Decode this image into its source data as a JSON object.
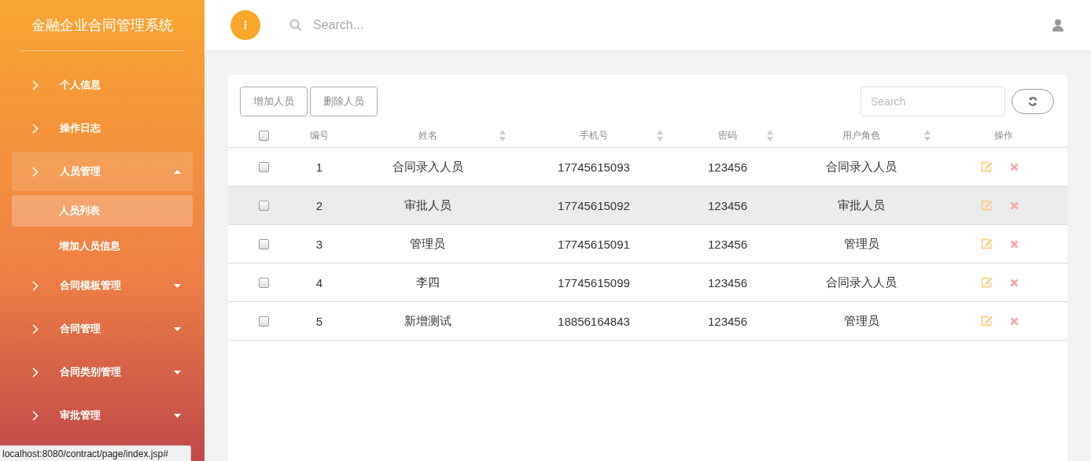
{
  "sidebar": {
    "title": "金融企业合同管理系统",
    "items": [
      {
        "label": "个人信息",
        "kind": "link"
      },
      {
        "label": "操作日志",
        "kind": "link"
      },
      {
        "label": "人员管理",
        "kind": "group",
        "expanded": true,
        "children": [
          {
            "label": "人员列表",
            "selected": true
          },
          {
            "label": "增加人员信息",
            "selected": false
          }
        ]
      },
      {
        "label": "合同模板管理",
        "kind": "group",
        "expanded": false
      },
      {
        "label": "合同管理",
        "kind": "group",
        "expanded": false
      },
      {
        "label": "合同类别管理",
        "kind": "group",
        "expanded": false
      },
      {
        "label": "审批管理",
        "kind": "group",
        "expanded": false
      }
    ]
  },
  "header": {
    "search": {
      "placeholder": "Search..."
    }
  },
  "toolbar": {
    "buttons": [
      "增加人员",
      "删除人员"
    ],
    "search": {
      "placeholder": "Search"
    }
  },
  "table": {
    "select_all": {
      "checked": false
    },
    "columns": [
      {
        "label": "编号",
        "sortable": false
      },
      {
        "label": "姓名",
        "sortable": true
      },
      {
        "label": "手机号",
        "sortable": true
      },
      {
        "label": "密码",
        "sortable": true
      },
      {
        "label": "用户角色",
        "sortable": true
      },
      {
        "label": "操作",
        "sortable": false
      }
    ],
    "rows": [
      {
        "checked": false,
        "hovered": false,
        "cells": [
          "1",
          "合同录入人员",
          "17745615093",
          "123456",
          "合同录入人员"
        ]
      },
      {
        "checked": false,
        "hovered": true,
        "cells": [
          "2",
          "审批人员",
          "17745615092",
          "123456",
          "审批人员"
        ]
      },
      {
        "checked": false,
        "hovered": false,
        "cells": [
          "3",
          "管理员",
          "17745615091",
          "123456",
          "管理员"
        ]
      },
      {
        "checked": false,
        "hovered": false,
        "cells": [
          "4",
          "李四",
          "17745615099",
          "123456",
          "合同录入人员"
        ]
      },
      {
        "checked": false,
        "hovered": false,
        "cells": [
          "5",
          "新增测试",
          "18856164843",
          "123456",
          "管理员"
        ]
      }
    ]
  },
  "status_bar": {
    "url": "localhost:8080/contract/page/index.jsp#"
  }
}
